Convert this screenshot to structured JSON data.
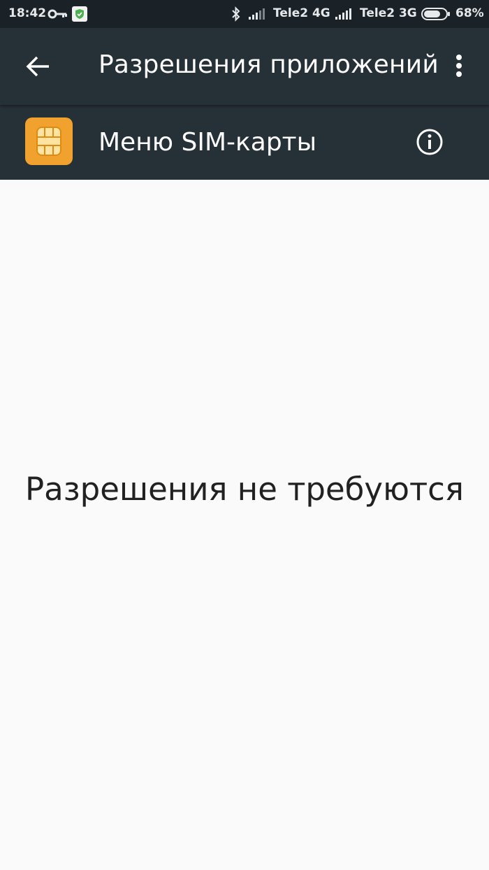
{
  "status_bar": {
    "time": "18:42",
    "operator1": "Tele2 4G",
    "operator2": "Tele2 3G",
    "battery_pct": "68%",
    "icons": [
      "key-icon",
      "shield-check-icon",
      "bluetooth-icon",
      "signal-icon",
      "signal-icon",
      "battery-icon"
    ]
  },
  "app_bar": {
    "title": "Разрешения приложений",
    "back_icon": "arrow-left-icon",
    "more_icon": "more-vert-icon"
  },
  "app_row": {
    "name": "Меню SIM-карты",
    "icon": "sim-card-icon",
    "icon_color": "#f0a12e",
    "info_icon": "info-icon"
  },
  "content": {
    "message": "Разрешения не требуются"
  },
  "colors": {
    "status_bar_bg": "#1b2227",
    "app_bar_bg": "#263037",
    "content_bg": "#fafafa"
  }
}
